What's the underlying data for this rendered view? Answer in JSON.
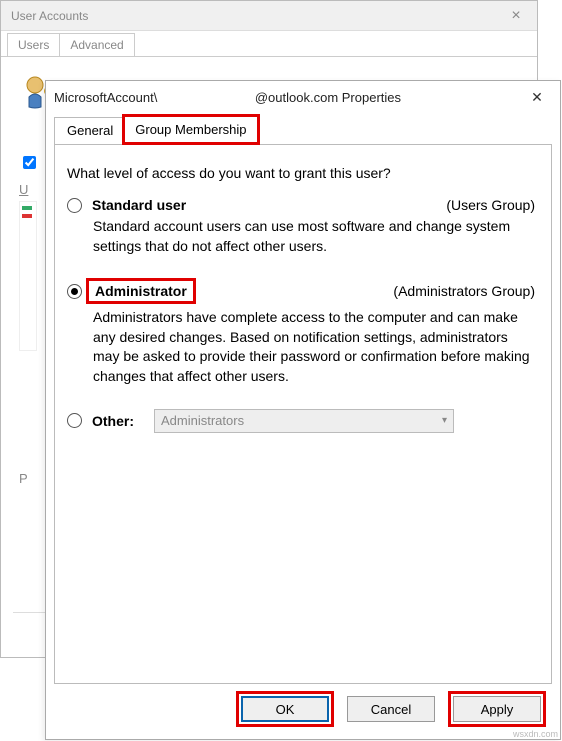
{
  "bg": {
    "title": "User Accounts",
    "tabs": [
      "Users",
      "Advanced"
    ],
    "userline": "MicrosoftAccount\\",
    "u_label": "U",
    "p_label": "P"
  },
  "fg": {
    "title_prefix": "MicrosoftAccount\\",
    "title_suffix": "@outlook.com Properties",
    "tabs": {
      "general": "General",
      "group": "Group Membership"
    },
    "question": "What level of access do you want to grant this user?",
    "standard": {
      "label": "Standard user",
      "group": "(Users Group)",
      "desc": "Standard account users can use most software and change system settings that do not affect other users."
    },
    "admin": {
      "label": "Administrator",
      "group": "(Administrators Group)",
      "desc": "Administrators have complete access to the computer and can make any desired changes. Based on notification settings, administrators may be asked to provide their password or confirmation before making changes that affect other users."
    },
    "other": {
      "label": "Other:",
      "selected": "Administrators"
    },
    "buttons": {
      "ok": "OK",
      "cancel": "Cancel",
      "apply": "Apply"
    }
  },
  "watermark": "wsxdn.com"
}
